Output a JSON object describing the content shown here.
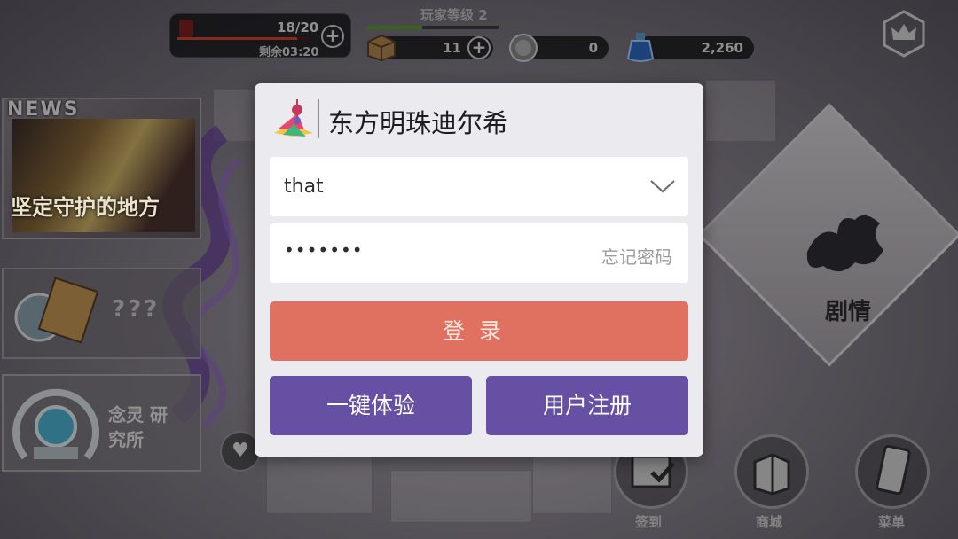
{
  "hud": {
    "stamina_count": "18/20",
    "stamina_timer": "剩余03:20",
    "stamina_fill": 0.9,
    "player_level": "玩家等级 2",
    "level_progress": 0.42,
    "crates_value": "11",
    "coins_value": "0",
    "gems_value": "2,260"
  },
  "left_panel": {
    "news_tag": "NEWS",
    "news_caption": "坚定守护的地方",
    "mystery_label": "???",
    "lab_label": "念灵 研究所"
  },
  "story": {
    "label": "剧情"
  },
  "bottom_nav": {
    "checkin_label": "签到",
    "shop_label": "商城",
    "menu_label": "菜单"
  },
  "login_modal": {
    "title": "东方明珠迪尔希",
    "account_value": "that",
    "password_value": "•••••••",
    "forgot_password": "忘记密码",
    "login_button": "登录",
    "trial_button": "一键体验",
    "register_button": "用户注册"
  },
  "colors": {
    "modal_bg": "#ebeaef",
    "login_btn": "#e07060",
    "purple_btn": "#6650a3"
  },
  "icons": [
    "fuel-icon",
    "plus-icon",
    "crate-icon",
    "coin-icon",
    "potion-icon",
    "crown-icon",
    "heart-icon",
    "calendar-check-icon",
    "shop-bag-icon",
    "phone-icon",
    "app-logo-icon",
    "chevron-down-icon"
  ]
}
